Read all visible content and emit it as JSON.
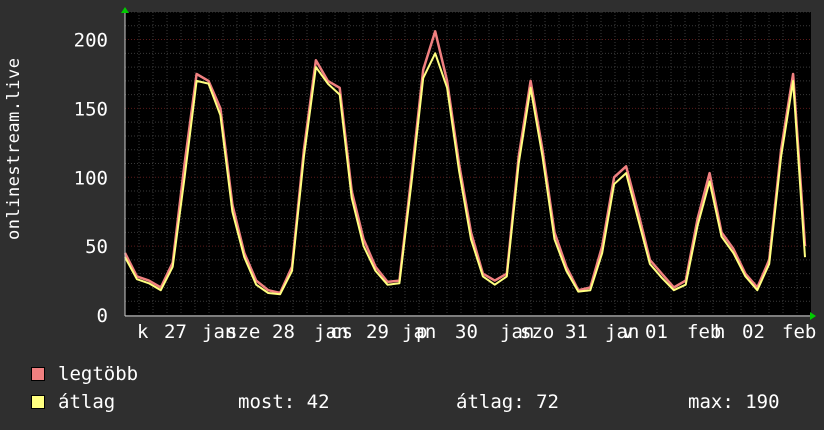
{
  "chart_data": {
    "type": "line",
    "ylabel": "onlinestream.live",
    "ylim": [
      0,
      220
    ],
    "y_ticks": [
      0,
      50,
      100,
      150,
      200
    ],
    "x_tick_labels": [
      "k",
      "27",
      "jan",
      "sze",
      "28",
      "jan",
      "cs",
      "29",
      "jan",
      "p",
      "30",
      "jan",
      "szo",
      "31",
      "jan",
      "v",
      "01",
      "feb",
      "h",
      "02",
      "feb"
    ],
    "grid": true,
    "x": [
      "26 12:00",
      "26 15:00",
      "26 18:00",
      "26 21:00",
      "27 00:00",
      "27 03:00",
      "27 06:00",
      "27 09:00",
      "27 12:00",
      "27 15:00",
      "27 18:00",
      "27 21:00",
      "28 00:00",
      "28 03:00",
      "28 06:00",
      "28 09:00",
      "28 12:00",
      "28 15:00",
      "28 18:00",
      "28 21:00",
      "29 00:00",
      "29 03:00",
      "29 06:00",
      "29 09:00",
      "29 12:00",
      "29 15:00",
      "29 18:00",
      "29 21:00",
      "30 00:00",
      "30 03:00",
      "30 06:00",
      "30 09:00",
      "30 12:00",
      "30 15:00",
      "30 18:00",
      "30 21:00",
      "31 00:00",
      "31 03:00",
      "31 06:00",
      "31 09:00",
      "31 12:00",
      "31 15:00",
      "31 18:00",
      "31 21:00",
      "01 00:00",
      "01 03:00",
      "01 06:00",
      "01 09:00",
      "01 12:00",
      "01 15:00",
      "01 18:00",
      "01 21:00",
      "02 00:00",
      "02 03:00",
      "02 06:00",
      "02 09:00",
      "02 12:00",
      "02 15:00"
    ],
    "series": [
      {
        "name": "legtöbb",
        "color": "#f08080",
        "values": [
          45,
          28,
          25,
          20,
          38,
          110,
          175,
          170,
          150,
          80,
          45,
          25,
          18,
          16,
          35,
          120,
          185,
          170,
          165,
          90,
          55,
          35,
          24,
          25,
          100,
          178,
          206,
          170,
          110,
          60,
          30,
          25,
          30,
          115,
          170,
          120,
          60,
          35,
          18,
          20,
          50,
          100,
          108,
          75,
          40,
          30,
          20,
          25,
          70,
          103,
          60,
          48,
          30,
          20,
          40,
          120,
          175,
          50
        ]
      },
      {
        "name": "átlag",
        "color": "#ffff80",
        "values": [
          42,
          26,
          23,
          18,
          35,
          100,
          170,
          168,
          145,
          75,
          42,
          22,
          16,
          15,
          32,
          115,
          180,
          168,
          160,
          85,
          50,
          32,
          22,
          23,
          95,
          172,
          190,
          165,
          105,
          55,
          28,
          22,
          28,
          110,
          165,
          115,
          55,
          32,
          17,
          18,
          45,
          95,
          103,
          70,
          37,
          27,
          18,
          22,
          65,
          97,
          57,
          45,
          28,
          18,
          37,
          115,
          170,
          42
        ]
      }
    ]
  },
  "legend": [
    {
      "label": "legtöbb",
      "color": "#f08080"
    },
    {
      "label": "átlag",
      "color": "#ffff80"
    }
  ],
  "stats": {
    "now": "most: 42",
    "avg": "átlag: 72",
    "max": "max: 190"
  }
}
